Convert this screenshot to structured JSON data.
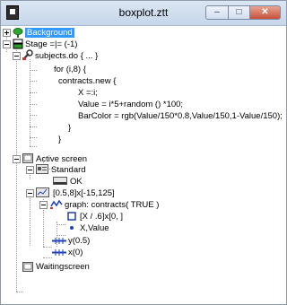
{
  "window": {
    "title": "boxplot.ztt",
    "minimize_glyph": "–",
    "maximize_glyph": "□",
    "close_glyph": "✕"
  },
  "tree": {
    "background": "Background",
    "stage": "Stage =|= (-1)",
    "subjects": "subjects.do { ... }",
    "code": {
      "line1": "for (i,8) {",
      "line2": "contracts.new {",
      "line3": "X =:i;",
      "line4": "Value = i*5+random () *100;",
      "line5": "BarColor  = rgb(Value/150*0.8,Value/150,1-Value/150);",
      "line6": "}",
      "line7": "}"
    },
    "active_screen": "Active screen",
    "standard": "Standard",
    "ok": "OK",
    "frame": "[0.5,8]x[-15,125]",
    "graph": "graph: contracts( TRUE )",
    "rect": "[X / .6]x[0, ]",
    "point": "X,Value",
    "y_axis": "y(0.5)",
    "x_axis": "x(0)",
    "waiting_screen": "Waitingscreen"
  },
  "colors": {
    "selection": "#3399ff",
    "stage_green": "#2a9a2a",
    "axis_blue": "#1f3fbf"
  }
}
